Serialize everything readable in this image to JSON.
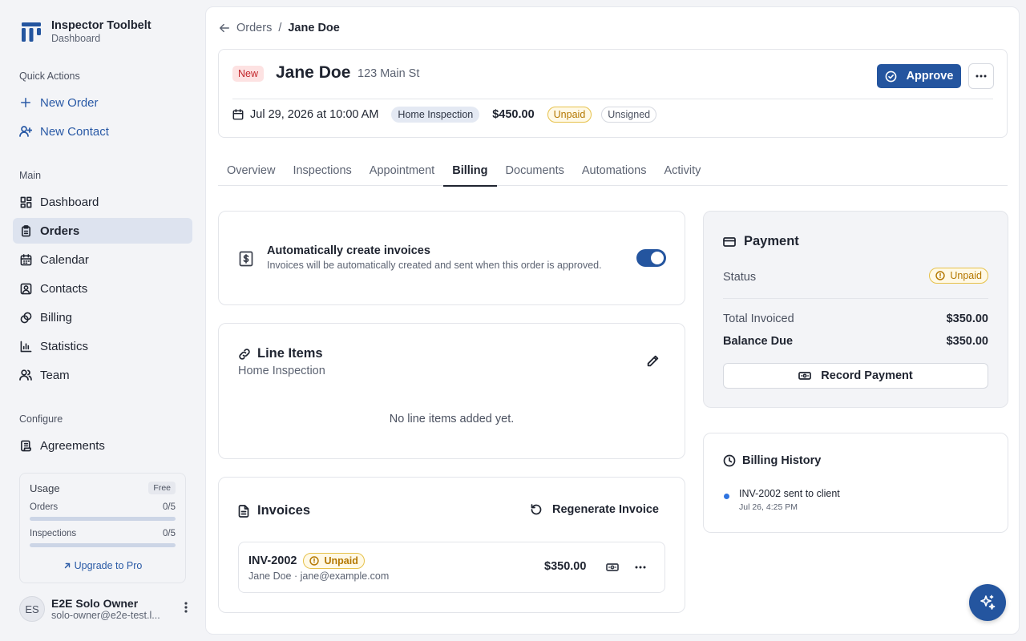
{
  "brand": {
    "title": "Inspector Toolbelt",
    "subtitle": "Dashboard"
  },
  "sidebar": {
    "quick_actions_label": "Quick Actions",
    "quick_actions": [
      {
        "label": "New Order",
        "icon": "plus-icon"
      },
      {
        "label": "New Contact",
        "icon": "user-plus-icon"
      }
    ],
    "main_label": "Main",
    "main_items": [
      {
        "label": "Dashboard",
        "icon": "grid-icon"
      },
      {
        "label": "Orders",
        "icon": "clipboard-icon",
        "active": true
      },
      {
        "label": "Calendar",
        "icon": "calendar-icon"
      },
      {
        "label": "Contacts",
        "icon": "contact-card-icon"
      },
      {
        "label": "Billing",
        "icon": "coins-icon"
      },
      {
        "label": "Statistics",
        "icon": "bar-chart-icon"
      },
      {
        "label": "Team",
        "icon": "users-icon"
      }
    ],
    "configure_label": "Configure",
    "configure_items": [
      {
        "label": "Agreements",
        "icon": "scroll-icon"
      }
    ],
    "usage": {
      "title": "Usage",
      "plan": "Free",
      "rows": [
        {
          "label": "Orders",
          "value": "0/5",
          "fraction": 0
        },
        {
          "label": "Inspections",
          "value": "0/5",
          "fraction": 0
        }
      ],
      "upgrade_label": "Upgrade to Pro"
    },
    "user": {
      "initials": "ES",
      "name": "E2E Solo Owner",
      "email": "solo-owner@e2e-test.l..."
    }
  },
  "breadcrumb": {
    "parent": "Orders",
    "separator": "/",
    "current": "Jane Doe"
  },
  "order": {
    "status_tag": "New",
    "customer_name": "Jane Doe",
    "address": "123 Main St",
    "approve_label": "Approve",
    "date": "Jul 29, 2026 at 10:00 AM",
    "service": "Home Inspection",
    "price": "$450.00",
    "payment_status": "Unpaid",
    "signature_status": "Unsigned"
  },
  "tabs": [
    "Overview",
    "Inspections",
    "Appointment",
    "Billing",
    "Documents",
    "Automations",
    "Activity"
  ],
  "active_tab": "Billing",
  "auto_invoices": {
    "title": "Automatically create invoices",
    "description": "Invoices will be automatically created and sent when this order is approved.",
    "enabled": true
  },
  "line_items": {
    "title": "Line Items",
    "subtitle": "Home Inspection",
    "empty_text": "No line items added yet."
  },
  "invoices": {
    "title": "Invoices",
    "regenerate_label": "Regenerate Invoice",
    "items": [
      {
        "number": "INV-2002",
        "status": "Unpaid",
        "client": "Jane Doe · jane@example.com",
        "amount": "$350.00"
      }
    ]
  },
  "payment": {
    "title": "Payment",
    "status_label": "Status",
    "status": "Unpaid",
    "total_invoiced_label": "Total Invoiced",
    "total_invoiced": "$350.00",
    "balance_due_label": "Balance Due",
    "balance_due": "$350.00",
    "record_label": "Record Payment"
  },
  "billing_history": {
    "title": "Billing History",
    "events": [
      {
        "text": "INV-2002 sent to client",
        "time": "Jul 26, 4:25 PM"
      }
    ]
  },
  "colors": {
    "primary": "#24559f",
    "unpaid": "#b47700",
    "new_tag": "#c3262b",
    "history_dot": "#2f74e0"
  }
}
